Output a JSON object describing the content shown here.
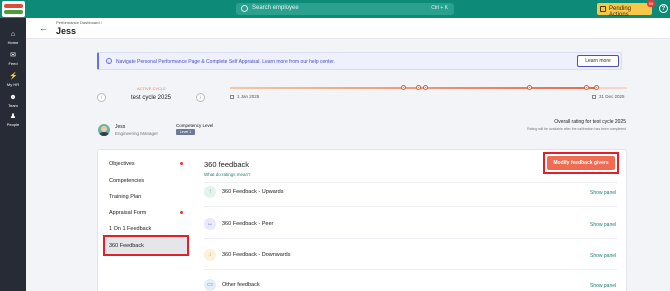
{
  "topbar": {
    "search_placeholder": "Search employee",
    "search_shortcut": "Ctrl + K",
    "pending_label": "Pending Actions",
    "pending_count": "99",
    "help_label": "?"
  },
  "nav": {
    "items": [
      {
        "label": "Home",
        "icon": "home-icon",
        "glyph": "⌂"
      },
      {
        "label": "Feed",
        "icon": "megaphone-icon",
        "glyph": "✉"
      },
      {
        "label": "My HR",
        "icon": "bolt-icon",
        "glyph": "⚡"
      },
      {
        "label": "Team",
        "icon": "team-icon",
        "glyph": "☻"
      },
      {
        "label": "People",
        "icon": "people-icon",
        "glyph": "♟"
      }
    ]
  },
  "header": {
    "back": "←",
    "breadcrumb": "Performance Dashboard /",
    "title": "Jess"
  },
  "banner": {
    "text": "Navigate Personal Performance Page & Complete Self Appraisal. Learn more from our help center.",
    "learn_more": "Learn more"
  },
  "cycle": {
    "active_label": "ACTIVE CYCLE",
    "name": "test cycle 2025",
    "prev": "‹",
    "next": "›",
    "start_date": "1 Jan 2025",
    "end_date": "31 Dec 2025",
    "progress": 0.92
  },
  "profile": {
    "name": "Jess",
    "role": "Engineering Manager",
    "competency_label": "Competency Level",
    "competency_level": "Level 1",
    "overall_label": "Overall rating for test cycle 2025",
    "overall_note": "Rating will be available after the calibration has been completed"
  },
  "sidebar": {
    "items": [
      {
        "label": "Objectives",
        "dot": true
      },
      {
        "label": "Competencies",
        "dot": false
      },
      {
        "label": "Training Plan",
        "dot": false
      },
      {
        "label": "Appraisal Form",
        "dot": true
      },
      {
        "label": "1 On 1 Feedback",
        "dot": false
      },
      {
        "label": "360 Feedback",
        "dot": false,
        "active": true
      }
    ]
  },
  "feedback": {
    "title": "360 feedback",
    "ratings_link": "What do ratings mean?",
    "modify_button": "Modify feedback givers",
    "rows": [
      {
        "label": "360 Feedback - Upwards",
        "icon": "arrow-up-icon",
        "glyph": "↑",
        "action": "Show panel",
        "color": "#3aa58a",
        "bg": "#e3f4ee"
      },
      {
        "label": "360 Feedback - Peer",
        "icon": "arrows-horizontal-icon",
        "glyph": "↔",
        "action": "Show panel",
        "color": "#5a5ec8",
        "bg": "#e8e9fb"
      },
      {
        "label": "360 Feedback - Downwards",
        "icon": "arrow-down-icon",
        "glyph": "↓",
        "action": "Show panel",
        "color": "#e0952a",
        "bg": "#fdf0dc"
      },
      {
        "label": "Other feedback",
        "icon": "chat-icon",
        "glyph": "▭",
        "action": "Show panel",
        "color": "#3a7fc8",
        "bg": "#e3eef9"
      }
    ]
  }
}
